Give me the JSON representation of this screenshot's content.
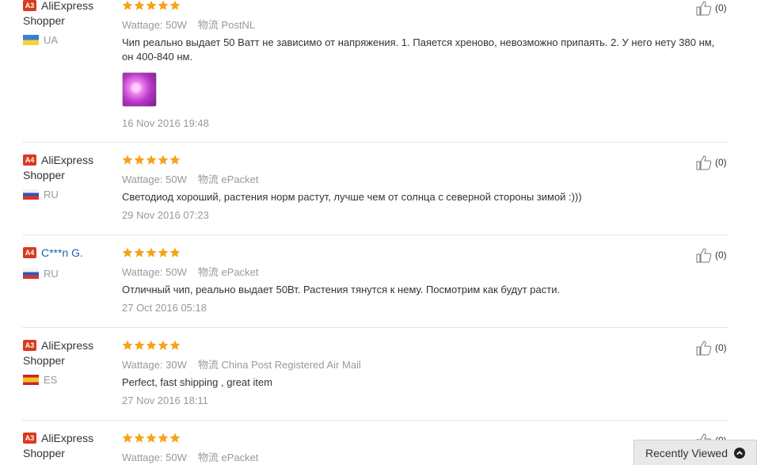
{
  "reviews": [
    {
      "level": "A3",
      "name_line1": "AliExpress",
      "name_line2": "Shopper",
      "country": "UA",
      "rating": 5,
      "wattage_label": "Wattage:",
      "wattage": "50W",
      "logistics_label": "物流",
      "logistics": "PostNL",
      "text": "Чип реально выдает 50 Ватт не зависимо от напряжения. 1. Паяется хреново, невозможно припаять. 2. У него нету 380 нм, он 400-840 нм.",
      "date": "16 Nov 2016 19:48",
      "helpful": "(0)"
    },
    {
      "level": "A4",
      "name_line1": "AliExpress",
      "name_line2": "Shopper",
      "country": "RU",
      "rating": 5,
      "wattage_label": "Wattage:",
      "wattage": "50W",
      "logistics_label": "物流",
      "logistics": "ePacket",
      "text": "Светодиод хороший, растения норм растут, лучше чем от солнца с северной стороны зимой :)))",
      "date": "29 Nov 2016 07:23",
      "helpful": "(0)"
    },
    {
      "level": "A4",
      "name_line1": "C***n G.",
      "name_line2": "",
      "country": "RU",
      "rating": 5,
      "wattage_label": "Wattage:",
      "wattage": "50W",
      "logistics_label": "物流",
      "logistics": "ePacket",
      "text": "Отличный чип, реально выдает 50Вт. Растения тянутся к нему. Посмотрим как будут расти.",
      "date": "27 Oct 2016 05:18",
      "helpful": "(0)"
    },
    {
      "level": "A3",
      "name_line1": "AliExpress",
      "name_line2": "Shopper",
      "country": "ES",
      "rating": 5,
      "wattage_label": "Wattage:",
      "wattage": "30W",
      "logistics_label": "物流",
      "logistics": "China Post Registered Air Mail",
      "text": "Perfect, fast shipping , great item",
      "date": "27 Nov 2016 18:11",
      "helpful": "(0)"
    },
    {
      "level": "A3",
      "name_line1": "AliExpress",
      "name_line2": "Shopper",
      "country": "",
      "rating": 5,
      "wattage_label": "Wattage:",
      "wattage": "50W",
      "logistics_label": "物流",
      "logistics": "ePacket",
      "text": "",
      "date": "",
      "helpful": "(0)"
    }
  ],
  "recently_viewed": {
    "label": "Recently Viewed",
    "icon": "chevron-up-circle-icon"
  },
  "colors": {
    "star": "#f8a21a",
    "badge": "#d93a1e",
    "link": "#1f62b3",
    "muted": "#999999"
  }
}
